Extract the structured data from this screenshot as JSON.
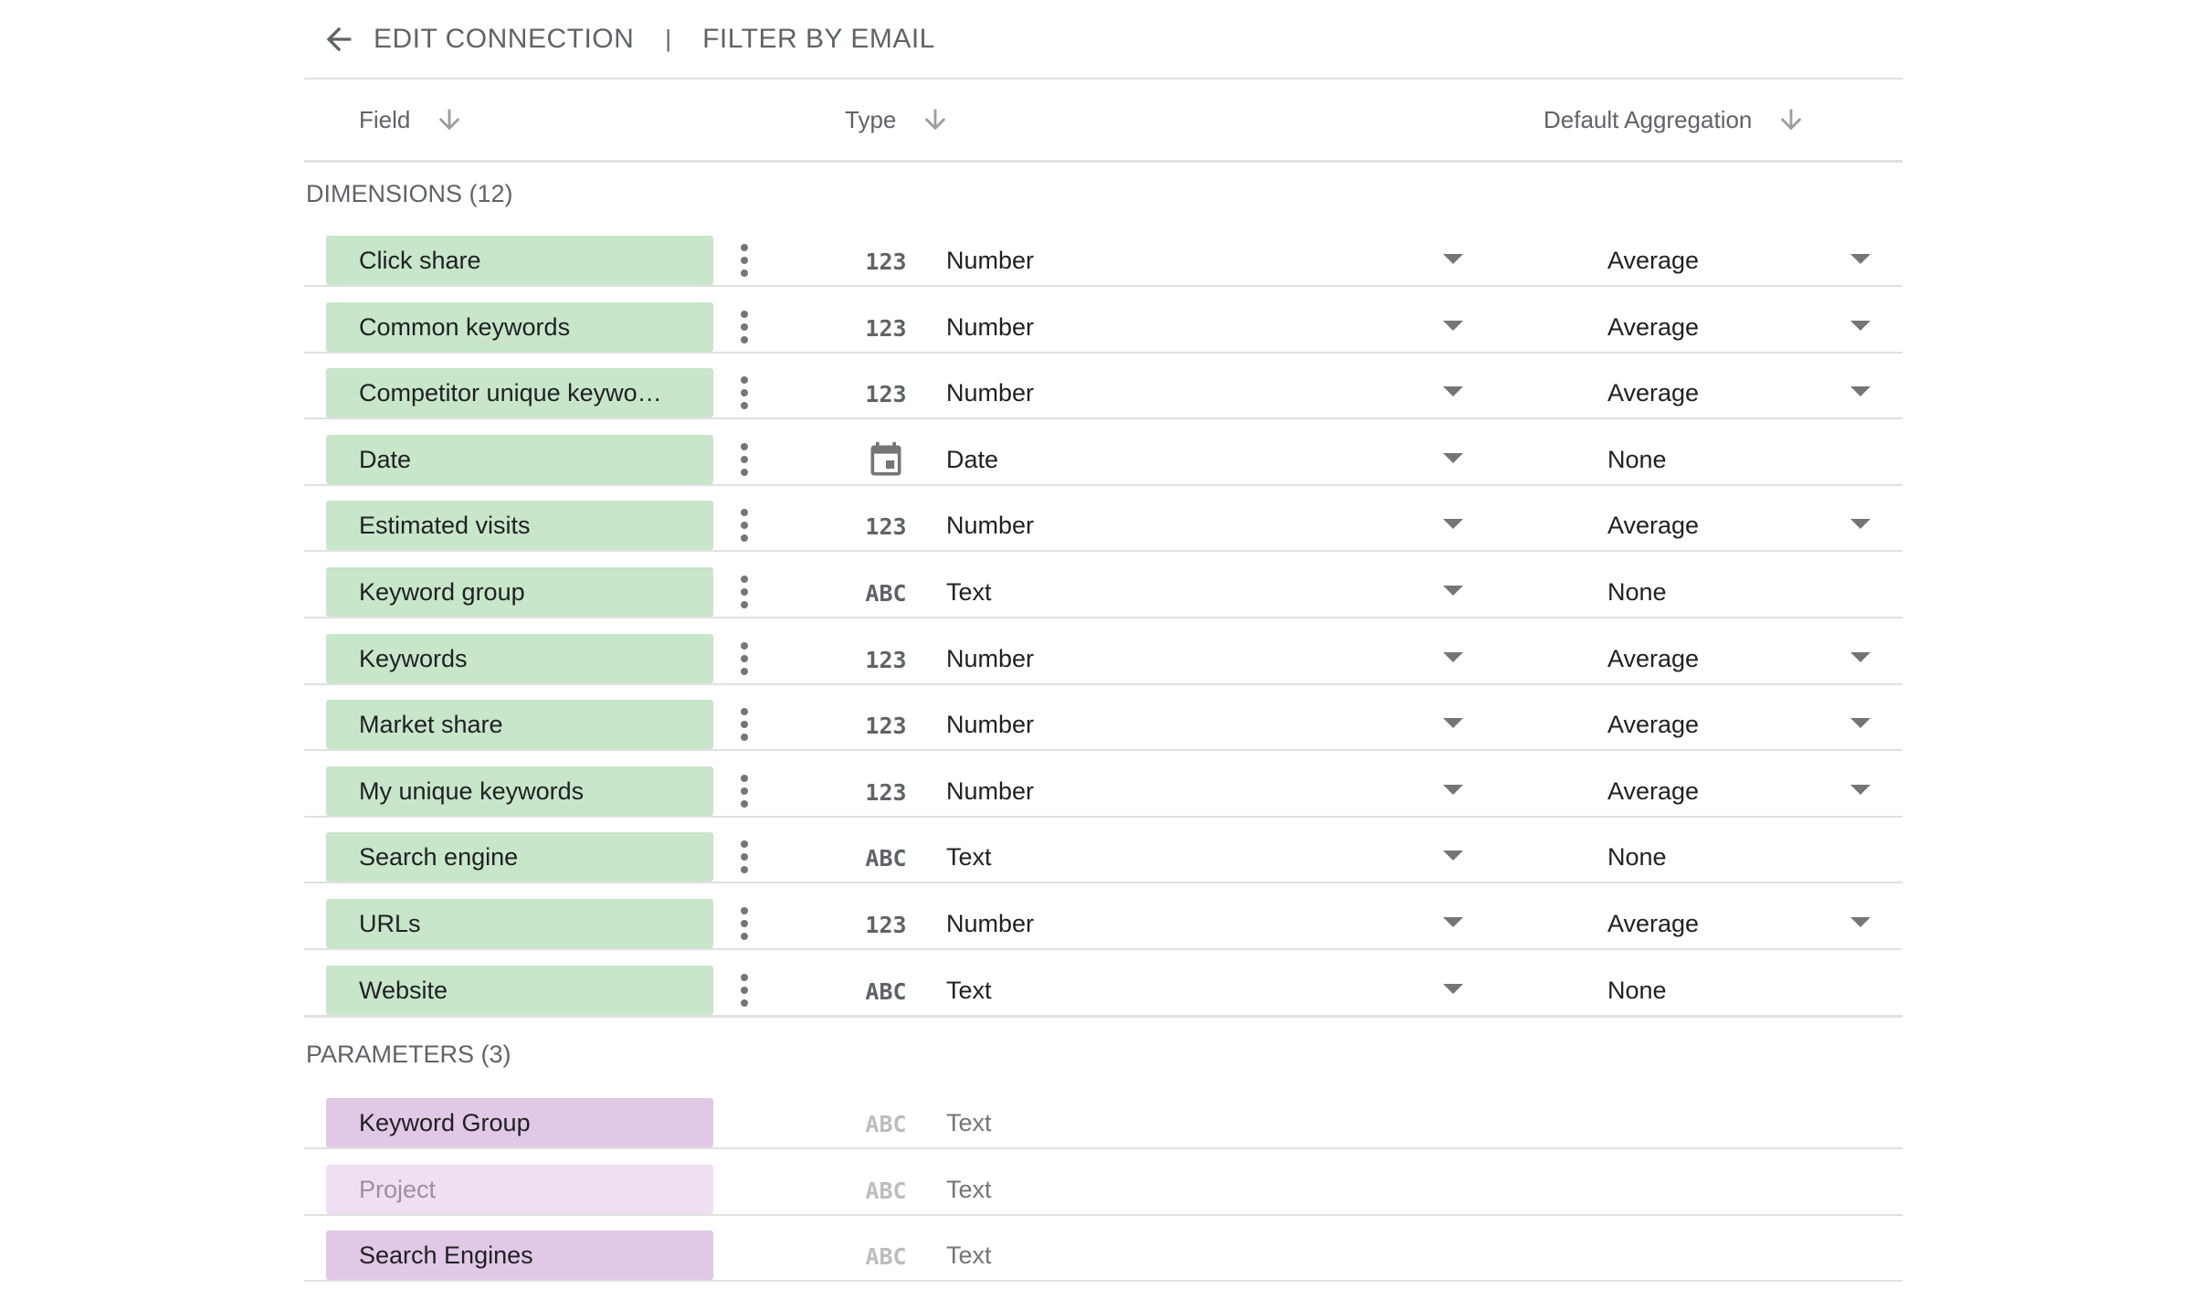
{
  "header": {
    "back_icon": "arrow-back-icon",
    "edit_connection_label": "EDIT CONNECTION",
    "separator": "|",
    "filter_label": "FILTER BY EMAIL"
  },
  "columns": {
    "field": "Field",
    "type": "Type",
    "aggregation": "Default Aggregation",
    "sort_icon": "arrow-down-icon"
  },
  "dimensions": {
    "title": "DIMENSIONS (12)",
    "rows": [
      {
        "name": "Click share",
        "type_icon": "123",
        "type": "Number",
        "aggregation": "Average",
        "agg_dropdown": true
      },
      {
        "name": "Common keywords",
        "type_icon": "123",
        "type": "Number",
        "aggregation": "Average",
        "agg_dropdown": true
      },
      {
        "name": "Competitor unique keywo…",
        "type_icon": "123",
        "type": "Number",
        "aggregation": "Average",
        "agg_dropdown": true
      },
      {
        "name": "Date",
        "type_icon": "calendar-icon",
        "type": "Date",
        "aggregation": "None",
        "agg_dropdown": false
      },
      {
        "name": "Estimated visits",
        "type_icon": "123",
        "type": "Number",
        "aggregation": "Average",
        "agg_dropdown": true
      },
      {
        "name": "Keyword group",
        "type_icon": "ABC",
        "type": "Text",
        "aggregation": "None",
        "agg_dropdown": false
      },
      {
        "name": "Keywords",
        "type_icon": "123",
        "type": "Number",
        "aggregation": "Average",
        "agg_dropdown": true
      },
      {
        "name": "Market share",
        "type_icon": "123",
        "type": "Number",
        "aggregation": "Average",
        "agg_dropdown": true
      },
      {
        "name": "My unique keywords",
        "type_icon": "123",
        "type": "Number",
        "aggregation": "Average",
        "agg_dropdown": true
      },
      {
        "name": "Search engine",
        "type_icon": "ABC",
        "type": "Text",
        "aggregation": "None",
        "agg_dropdown": false
      },
      {
        "name": "URLs",
        "type_icon": "123",
        "type": "Number",
        "aggregation": "Average",
        "agg_dropdown": true
      },
      {
        "name": "Website",
        "type_icon": "ABC",
        "type": "Text",
        "aggregation": "None",
        "agg_dropdown": false
      }
    ]
  },
  "parameters": {
    "title": "PARAMETERS (3)",
    "rows": [
      {
        "name": "Keyword Group",
        "type_icon": "ABC",
        "type": "Text",
        "faded": false
      },
      {
        "name": "Project",
        "type_icon": "ABC",
        "type": "Text",
        "faded": true
      },
      {
        "name": "Search Engines",
        "type_icon": "ABC",
        "type": "Text",
        "faded": false
      }
    ]
  },
  "colors": {
    "dimension_chip": "#c8e6c9",
    "parameter_chip": "#e1c8e6",
    "parameter_chip_faded": "#efdff2",
    "muted_text": "#5f6368",
    "divider": "#e0e0e0"
  }
}
